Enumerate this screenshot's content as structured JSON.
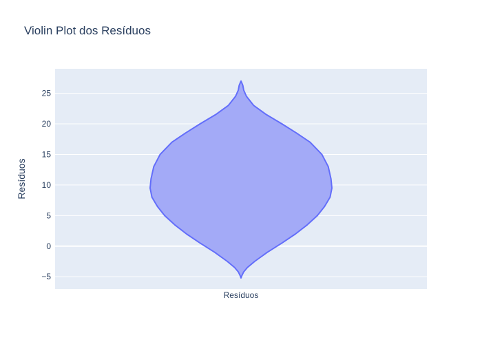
{
  "chart_data": {
    "type": "violin",
    "title": "Violin Plot dos Resíduos",
    "categories": [
      "Resíduos"
    ],
    "ylabel": "Resíduos",
    "ylim": [
      -7,
      29
    ],
    "yticks": [
      -5,
      0,
      5,
      10,
      15,
      20,
      25
    ],
    "ytick_labels": [
      "−5",
      "0",
      "5",
      "10",
      "15",
      "20",
      "25"
    ],
    "grid": true,
    "colors": {
      "plot_background": "#e5ecf6",
      "grid": "#ffffff",
      "violin_fill": "#a3aaf7",
      "violin_line": "#636efa",
      "text": "#2a3f5f"
    },
    "series": [
      {
        "category": "Resíduos",
        "min": -5.2,
        "max": 27.0,
        "density_profile": [
          {
            "y": -5.2,
            "width": 0.0
          },
          {
            "y": -4.8,
            "width": 0.01
          },
          {
            "y": -4.2,
            "width": 0.03
          },
          {
            "y": -3.5,
            "width": 0.07
          },
          {
            "y": -2.5,
            "width": 0.15
          },
          {
            "y": -1.0,
            "width": 0.29
          },
          {
            "y": 0.5,
            "width": 0.45
          },
          {
            "y": 2.0,
            "width": 0.6
          },
          {
            "y": 3.5,
            "width": 0.73
          },
          {
            "y": 5.0,
            "width": 0.84
          },
          {
            "y": 6.5,
            "width": 0.92
          },
          {
            "y": 8.0,
            "width": 0.98
          },
          {
            "y": 9.5,
            "width": 1.0
          },
          {
            "y": 11.0,
            "width": 0.99
          },
          {
            "y": 13.0,
            "width": 0.96
          },
          {
            "y": 15.0,
            "width": 0.89
          },
          {
            "y": 17.0,
            "width": 0.76
          },
          {
            "y": 18.5,
            "width": 0.61
          },
          {
            "y": 20.0,
            "width": 0.45
          },
          {
            "y": 21.5,
            "width": 0.28
          },
          {
            "y": 23.0,
            "width": 0.14
          },
          {
            "y": 24.5,
            "width": 0.06
          },
          {
            "y": 25.5,
            "width": 0.03
          },
          {
            "y": 26.3,
            "width": 0.02
          },
          {
            "y": 27.0,
            "width": 0.0
          }
        ]
      }
    ]
  }
}
